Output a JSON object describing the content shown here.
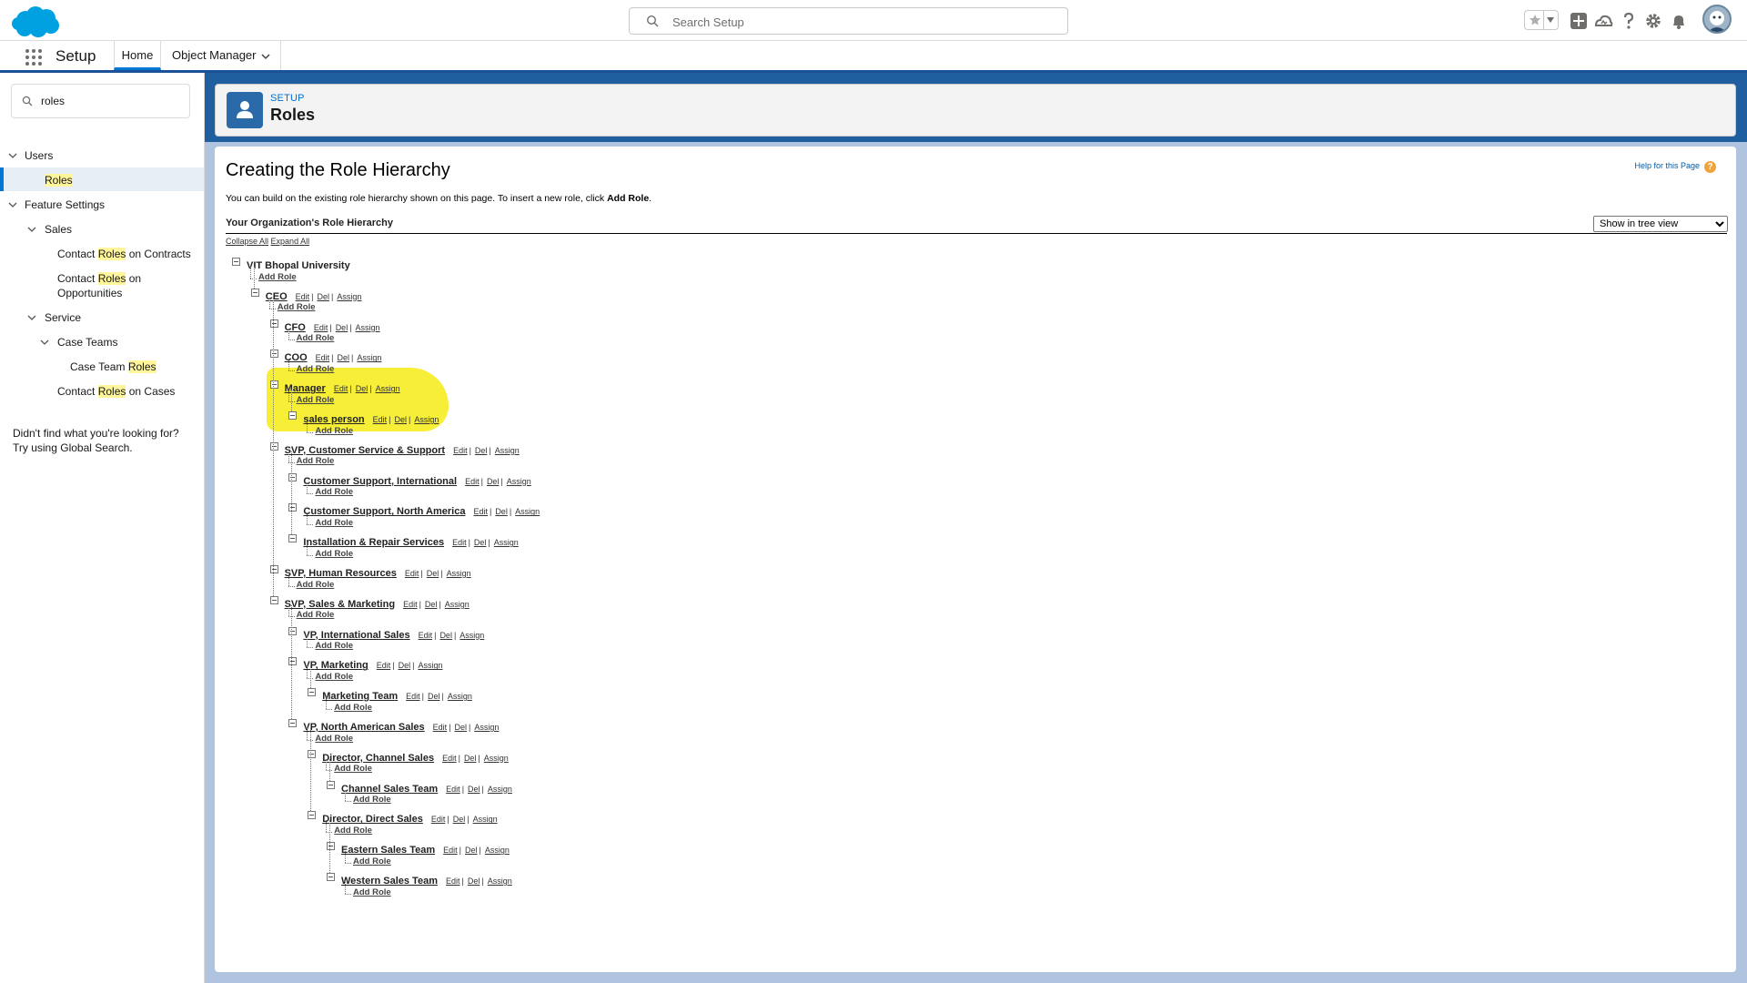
{
  "header": {
    "search_placeholder": "Search Setup",
    "icons": [
      "star-icon",
      "chevron-down-icon",
      "plus-icon",
      "trailhead-icon",
      "help-icon",
      "gear-icon",
      "bell-icon",
      "avatar"
    ]
  },
  "context_bar": {
    "app_name": "Setup",
    "tabs": [
      {
        "label": "Home"
      },
      {
        "label": "Object Manager"
      }
    ]
  },
  "sidebar": {
    "quick_find_value": "roles",
    "items": [
      {
        "label_pre": "",
        "label_hl": "",
        "label_post": "Users"
      },
      {
        "label_pre": "",
        "label_hl": "Roles",
        "label_post": ""
      },
      {
        "label_pre": "",
        "label_hl": "",
        "label_post": "Feature Settings"
      },
      {
        "label_pre": "",
        "label_hl": "",
        "label_post": "Sales"
      },
      {
        "label_pre": "Contact ",
        "label_hl": "Roles",
        "label_post": " on Contracts"
      },
      {
        "label_pre": "Contact ",
        "label_hl": "Roles",
        "label_post": " on"
      },
      {
        "label_pre": "",
        "label_hl": "",
        "label_post": "Opportunities"
      },
      {
        "label_pre": "",
        "label_hl": "",
        "label_post": "Service"
      },
      {
        "label_pre": "",
        "label_hl": "",
        "label_post": "Case Teams"
      },
      {
        "label_pre": "Case Team ",
        "label_hl": "Roles",
        "label_post": ""
      },
      {
        "label_pre": "Contact ",
        "label_hl": "Roles",
        "label_post": " on Cases"
      }
    ],
    "not_found_line1": "Didn't find what you're looking for?",
    "not_found_line2": "Try using Global Search."
  },
  "page_header": {
    "eyebrow": "SETUP",
    "title": "Roles"
  },
  "content": {
    "heading": "Creating the Role Hierarchy",
    "help_link": "Help for this Page",
    "intro_text": "You can build on the existing role hierarchy shown on this page. To insert a new role, click ",
    "intro_bold": "Add Role",
    "intro_end": ".",
    "hierarchy_title": "Your Organization's Role Hierarchy",
    "view_options": [
      "Show in tree view"
    ],
    "collapse_all": "Collapse All",
    "expand_all": "Expand All",
    "actions": {
      "edit": "Edit",
      "del": "Del",
      "assign": "Assign",
      "sep": "|",
      "add_role": "Add Role"
    }
  },
  "roles": [
    {
      "name": "VIT Bhopal University",
      "depth": 0,
      "root": true
    },
    {
      "name": "CEO",
      "depth": 1
    },
    {
      "name": "CFO",
      "depth": 2
    },
    {
      "name": "COO",
      "depth": 2
    },
    {
      "name": "Manager",
      "depth": 2,
      "highlighted": true
    },
    {
      "name": "sales person",
      "depth": 3,
      "highlighted": true
    },
    {
      "name": "SVP, Customer Service & Support",
      "depth": 2
    },
    {
      "name": "Customer Support, International",
      "depth": 3
    },
    {
      "name": "Customer Support, North America",
      "depth": 3
    },
    {
      "name": "Installation & Repair Services",
      "depth": 3
    },
    {
      "name": "SVP, Human Resources",
      "depth": 2
    },
    {
      "name": "SVP, Sales & Marketing",
      "depth": 2
    },
    {
      "name": "VP, International Sales",
      "depth": 3
    },
    {
      "name": "VP, Marketing",
      "depth": 3
    },
    {
      "name": "Marketing Team",
      "depth": 4
    },
    {
      "name": "VP, North American Sales",
      "depth": 3
    },
    {
      "name": "Director, Channel Sales",
      "depth": 4
    },
    {
      "name": "Channel Sales Team",
      "depth": 5
    },
    {
      "name": "Director, Direct Sales",
      "depth": 4
    },
    {
      "name": "Eastern Sales Team",
      "depth": 5
    },
    {
      "name": "Western Sales Team",
      "depth": 5
    }
  ],
  "colors": {
    "brand_blue": "#0176d3",
    "header_band": "#1f5fa0",
    "highlight_yellow": "#f5ec1b",
    "search_highlight": "#fff59a",
    "help_icon": "#f0a23b"
  }
}
